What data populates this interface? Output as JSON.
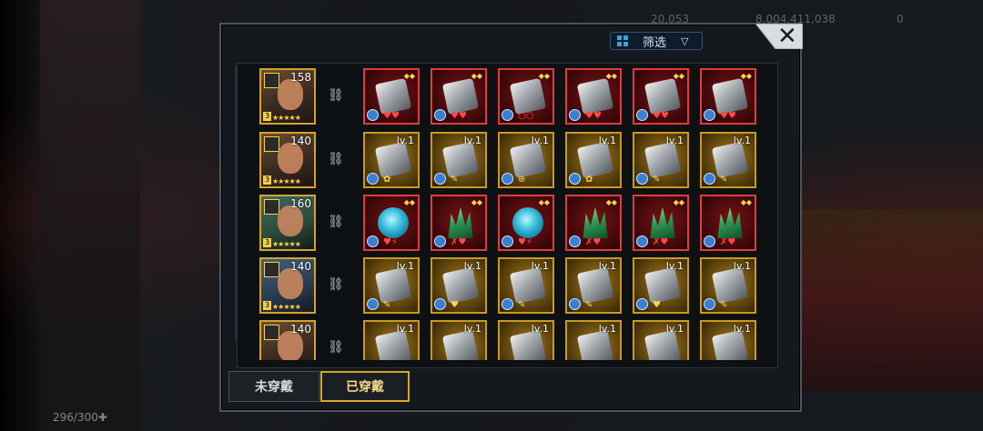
{
  "filter": {
    "label": "筛选",
    "arrow": "▽"
  },
  "close": {
    "glyph": "✕"
  },
  "background": {
    "top_values": [
      "20,053",
      "8,004,411,038",
      "0"
    ],
    "bottom_left": "296/300✚"
  },
  "rows": [
    {
      "hero_level": "158",
      "equip": [
        {
          "type": "hammer",
          "rarity": "red",
          "lv": "",
          "sub": "♥♥"
        },
        {
          "type": "hammer",
          "rarity": "red",
          "lv": "",
          "sub": "♥♥"
        },
        {
          "type": "hammer",
          "rarity": "red",
          "lv": "",
          "sub": "○○"
        },
        {
          "type": "hammer",
          "rarity": "red",
          "lv": "",
          "sub": "♥♥"
        },
        {
          "type": "hammer",
          "rarity": "red",
          "lv": "",
          "sub": "♥♥"
        },
        {
          "type": "hammer",
          "rarity": "red",
          "lv": "",
          "sub": "♥♥"
        }
      ]
    },
    {
      "hero_level": "140",
      "equip": [
        {
          "type": "hammer",
          "rarity": "gold",
          "lv": "lv.1",
          "sub": "✿"
        },
        {
          "type": "hammer",
          "rarity": "gold",
          "lv": "lv.1",
          "sub": "✎"
        },
        {
          "type": "hammer",
          "rarity": "gold",
          "lv": "lv.1",
          "sub": "⊕"
        },
        {
          "type": "hammer",
          "rarity": "gold",
          "lv": "lv.1",
          "sub": "✿"
        },
        {
          "type": "hammer",
          "rarity": "gold",
          "lv": "lv.1",
          "sub": "✎"
        },
        {
          "type": "hammer",
          "rarity": "gold",
          "lv": "lv.1",
          "sub": "✎"
        }
      ]
    },
    {
      "hero_level": "160",
      "equip": [
        {
          "type": "orb",
          "rarity": "red",
          "lv": "",
          "sub": "♥⚡"
        },
        {
          "type": "crystal",
          "rarity": "red",
          "lv": "",
          "sub": "✗♥"
        },
        {
          "type": "orb",
          "rarity": "red",
          "lv": "",
          "sub": "♥⚡"
        },
        {
          "type": "crystal",
          "rarity": "red",
          "lv": "",
          "sub": "✗♥"
        },
        {
          "type": "crystal",
          "rarity": "red",
          "lv": "",
          "sub": "✗♥"
        },
        {
          "type": "crystal",
          "rarity": "red",
          "lv": "",
          "sub": "✗♥"
        }
      ]
    },
    {
      "hero_level": "140",
      "equip": [
        {
          "type": "hammer",
          "rarity": "gold",
          "lv": "lv.1",
          "sub": "✎"
        },
        {
          "type": "hammer",
          "rarity": "gold",
          "lv": "lv.1",
          "sub": "♥"
        },
        {
          "type": "hammer",
          "rarity": "gold",
          "lv": "lv.1",
          "sub": "✎"
        },
        {
          "type": "hammer",
          "rarity": "gold",
          "lv": "lv.1",
          "sub": "✎"
        },
        {
          "type": "hammer",
          "rarity": "gold",
          "lv": "lv.1",
          "sub": "♥"
        },
        {
          "type": "hammer",
          "rarity": "gold",
          "lv": "lv.1",
          "sub": "✎"
        }
      ]
    },
    {
      "hero_level": "140",
      "equip": [
        {
          "type": "hammer",
          "rarity": "gold",
          "lv": "lv.1",
          "sub": ""
        },
        {
          "type": "hammer",
          "rarity": "gold",
          "lv": "lv.1",
          "sub": ""
        },
        {
          "type": "hammer",
          "rarity": "gold",
          "lv": "lv.1",
          "sub": ""
        },
        {
          "type": "hammer",
          "rarity": "gold",
          "lv": "lv.1",
          "sub": ""
        },
        {
          "type": "hammer",
          "rarity": "gold",
          "lv": "lv.1",
          "sub": ""
        },
        {
          "type": "hammer",
          "rarity": "gold",
          "lv": "lv.1",
          "sub": ""
        }
      ]
    }
  ],
  "tabs": {
    "unequipped": "未穿戴",
    "equipped": "已穿戴"
  },
  "colors": {
    "accent_gold": "#d8a623",
    "rarity_red": "#e43b3b",
    "filter_icon": "#3da2e4"
  }
}
